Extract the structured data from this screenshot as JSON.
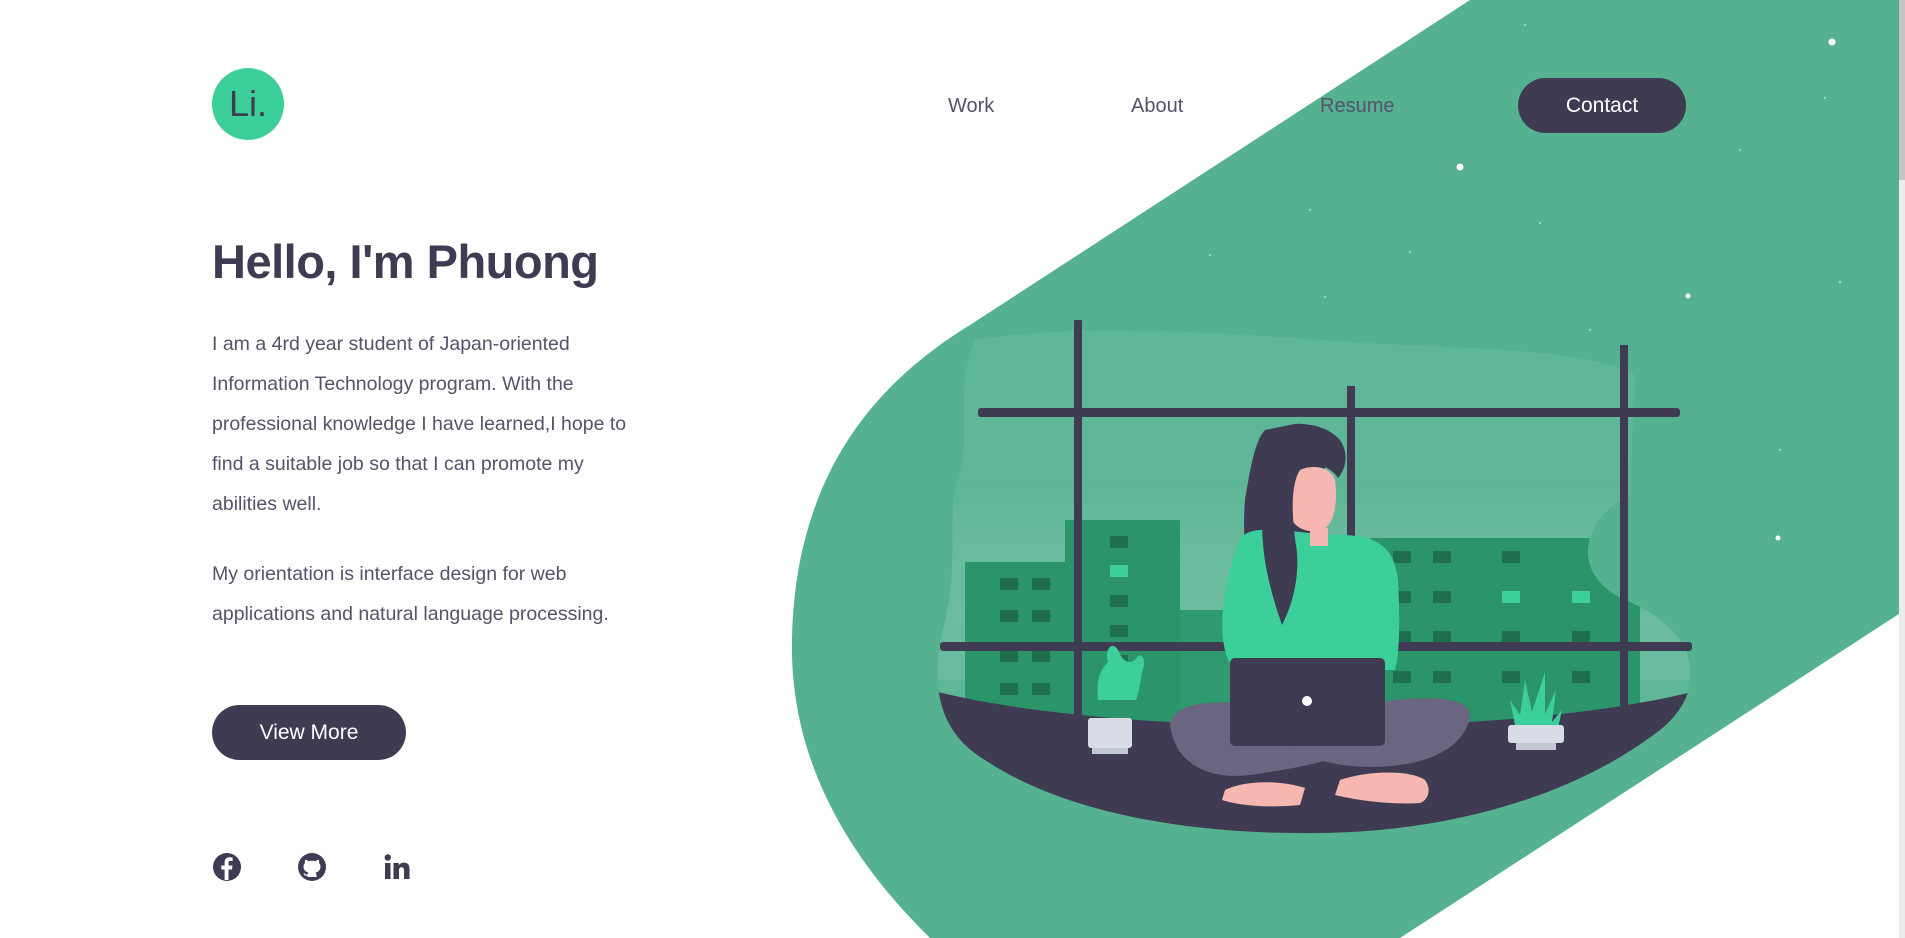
{
  "brand": {
    "logo_text": "Li.",
    "color": "#3ccf99"
  },
  "nav": {
    "items": [
      {
        "label": "Work"
      },
      {
        "label": "About"
      },
      {
        "label": "Resume"
      }
    ],
    "contact_label": "Contact"
  },
  "hero": {
    "title": "Hello, I'm Phuong",
    "paragraph_1": "I am a 4rd year student of Japan-oriented Information Technology program. With the professional knowledge I have learned,I hope to find a suitable job so that I can promote my abilities well.",
    "paragraph_2": "My orientation is interface design for web applications and natural language processing.",
    "cta_label": "View More"
  },
  "socials": [
    {
      "icon": "facebook-icon"
    },
    {
      "icon": "github-icon"
    },
    {
      "icon": "linkedin-icon"
    }
  ],
  "colors": {
    "accent": "#3ccf99",
    "background_shape": "#55b190",
    "dark": "#3e3b52"
  }
}
